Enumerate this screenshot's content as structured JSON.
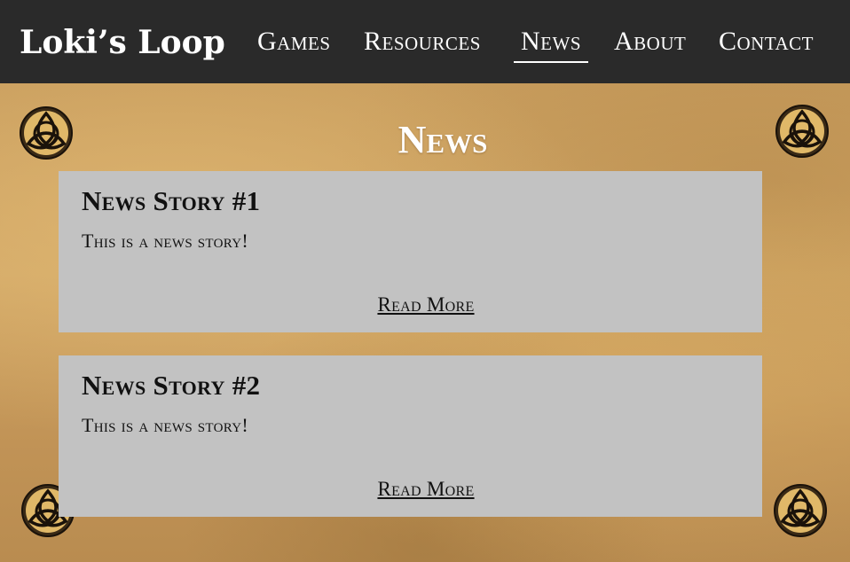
{
  "brand": {
    "logo_text": "Loki’s Loop"
  },
  "nav": {
    "items": [
      {
        "label": "Games",
        "active": false
      },
      {
        "label": "Resources",
        "active": false
      },
      {
        "label": "News",
        "active": true
      },
      {
        "label": "About",
        "active": false
      },
      {
        "label": "Contact",
        "active": false
      }
    ]
  },
  "page": {
    "title": "News"
  },
  "stories": [
    {
      "title": "News Story #1",
      "body": "This is a news story!",
      "link": "Read More"
    },
    {
      "title": "News Story #2",
      "body": "This is a news story!",
      "link": "Read More"
    }
  ],
  "decorations": {
    "corner_icon": "triquetra-icon"
  },
  "colors": {
    "navbar": "#2a2a2a",
    "card": "#c2c2c2",
    "text_light": "#ffffff",
    "text_dark": "#111111",
    "background": "#c49a5a"
  }
}
